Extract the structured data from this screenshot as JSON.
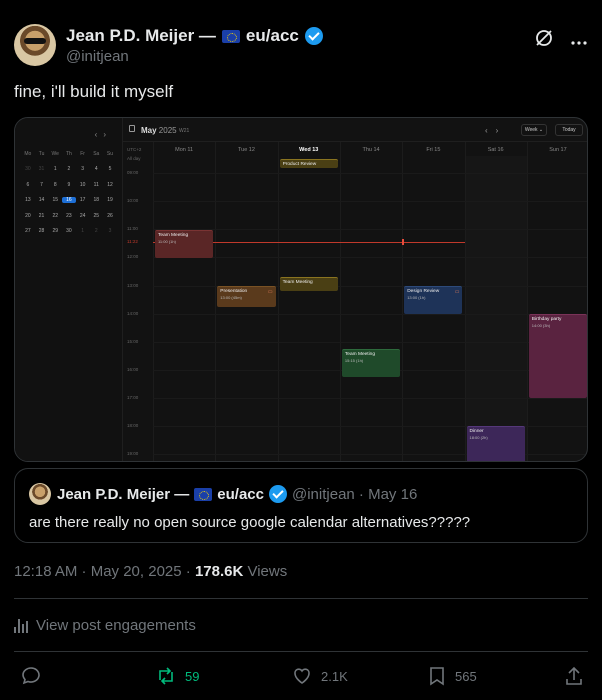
{
  "author": {
    "name": "Jean P.D. Meijer —",
    "name_suffix": "eu/acc",
    "handle": "@initjean"
  },
  "tweet": {
    "text": "fine, i'll build it myself"
  },
  "calendar": {
    "mini": {
      "dow": [
        "Mo",
        "Tu",
        "We",
        "Th",
        "Fr",
        "Sa",
        "Su"
      ],
      "weeks": [
        [
          "30",
          "31",
          "1",
          "2",
          "3",
          "4",
          "5"
        ],
        [
          "6",
          "7",
          "8",
          "9",
          "10",
          "11",
          "12"
        ],
        [
          "13",
          "14",
          "15",
          "16",
          "17",
          "18",
          "19"
        ],
        [
          "20",
          "21",
          "22",
          "23",
          "24",
          "25",
          "26"
        ],
        [
          "27",
          "28",
          "29",
          "30",
          "1",
          "2",
          "3"
        ]
      ],
      "selected": "16"
    },
    "month": "May",
    "year": "2025",
    "week_no": "W21",
    "view_label": "Week",
    "today_label": "Today",
    "tz_label": "UTC+2",
    "allday_label": "All day",
    "days": [
      {
        "dow": "Mon",
        "num": "11"
      },
      {
        "dow": "Tue",
        "num": "12"
      },
      {
        "dow": "Wed",
        "num": "13"
      },
      {
        "dow": "Thu",
        "num": "14"
      },
      {
        "dow": "Fri",
        "num": "15"
      },
      {
        "dow": "Sat",
        "num": "16"
      },
      {
        "dow": "Sun",
        "num": "17"
      }
    ],
    "hours": [
      "09:00",
      "10:00",
      "11:00",
      "11:22",
      "12:00",
      "13:00",
      "14:00",
      "15:00",
      "16:00",
      "17:00",
      "18:00",
      "19:00"
    ],
    "events": [
      {
        "title": "Product Review",
        "sub": "",
        "day": 2
      },
      {
        "title": "Team Meeting",
        "sub": "11:00 (1h)",
        "day": 0
      },
      {
        "title": "Presentation",
        "sub": "13:00 (45m)",
        "day": 1
      },
      {
        "title": "Team Meeting",
        "sub": "",
        "day": 2
      },
      {
        "title": "Design Review",
        "sub": "13:00 (1h)",
        "day": 4
      },
      {
        "title": "Birthday party",
        "sub": "14:00 (3h)",
        "day": 6
      },
      {
        "title": "Team Meeting",
        "sub": "15:15 (1h)",
        "day": 3
      },
      {
        "title": "Dinner",
        "sub": "18:00 (2h)",
        "day": 5
      }
    ],
    "colors": {
      "red": "#5a2626",
      "orange": "#5a3a1c",
      "yellow": "#4a3f14",
      "blue": "#1e3358",
      "green": "#1f4a2a",
      "pink": "#5a2340",
      "purple": "#3d2759"
    }
  },
  "quote": {
    "name": "Jean P.D. Meijer —",
    "name_suffix": "eu/acc",
    "handle_date": "@initjean · May 16",
    "text": "are there really no open source google calendar alternatives?????"
  },
  "meta": {
    "time": "12:18 AM · May 20, 2025 ·",
    "views_count": "178.6K",
    "views_label": "Views"
  },
  "engagements_label": "View post engagements",
  "actions": {
    "retweets": "59",
    "likes": "2.1K",
    "bookmarks": "565"
  }
}
